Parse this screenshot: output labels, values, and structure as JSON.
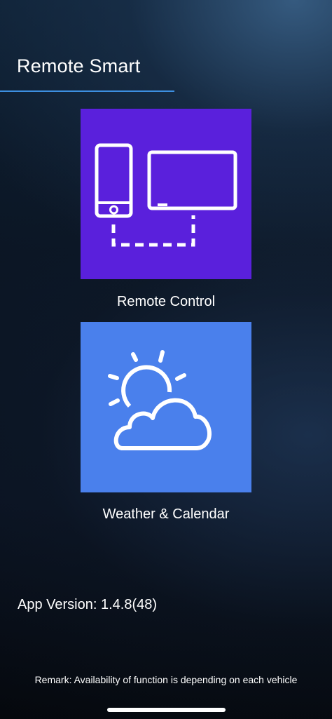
{
  "header": {
    "title": "Remote Smart"
  },
  "menu": {
    "items": [
      {
        "label": "Remote Control",
        "icon": "phone-tv-connection-icon",
        "color": "#5a20dc"
      },
      {
        "label": "Weather & Calendar",
        "icon": "sun-cloud-icon",
        "color": "#4a80ec"
      }
    ]
  },
  "footer": {
    "version": "App Version: 1.4.8(48)",
    "remark": "Remark: Availability of function is depending on each vehicle"
  },
  "colors": {
    "accent_line": "#3d8fe0",
    "background": "#0b1523"
  }
}
